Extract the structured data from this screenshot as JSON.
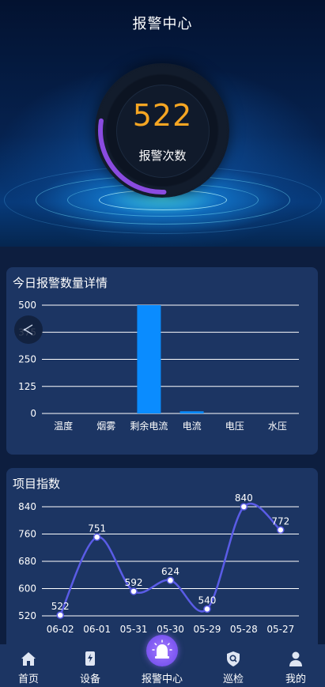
{
  "header": {
    "title": "报警中心"
  },
  "summary": {
    "alarm_count": "522",
    "alarm_count_label": "报警次数",
    "gauge_fill": 0.28
  },
  "today_card": {
    "title": "今日报警数量详情",
    "chart_data": {
      "type": "bar",
      "categories": [
        "温度",
        "烟雾",
        "剩余电流",
        "电流",
        "电压",
        "水压"
      ],
      "values": [
        0,
        0,
        500,
        10,
        0,
        0
      ],
      "yticks": [
        "0",
        "125",
        "250",
        "375",
        "500"
      ],
      "ylim": [
        0,
        500
      ],
      "grid": true,
      "color": "#0a8cff"
    }
  },
  "project_card": {
    "title": "项目指数",
    "chart_data": {
      "type": "line",
      "x": [
        "06-02",
        "06-01",
        "05-31",
        "05-30",
        "05-29",
        "05-28",
        "05-27"
      ],
      "values": [
        522,
        751,
        592,
        624,
        540,
        840,
        772
      ],
      "yticks": [
        "520",
        "600",
        "680",
        "760",
        "840"
      ],
      "ylim": [
        520,
        840
      ],
      "grid": true,
      "color": "#5a5ce6"
    }
  },
  "nav": {
    "items": [
      {
        "label": "首页",
        "icon": "home-icon"
      },
      {
        "label": "设备",
        "icon": "device-icon"
      },
      {
        "label": "报警中心",
        "icon": "alarm-light-icon"
      },
      {
        "label": "巡检",
        "icon": "inspection-shield-icon"
      },
      {
        "label": "我的",
        "icon": "user-icon"
      }
    ]
  }
}
